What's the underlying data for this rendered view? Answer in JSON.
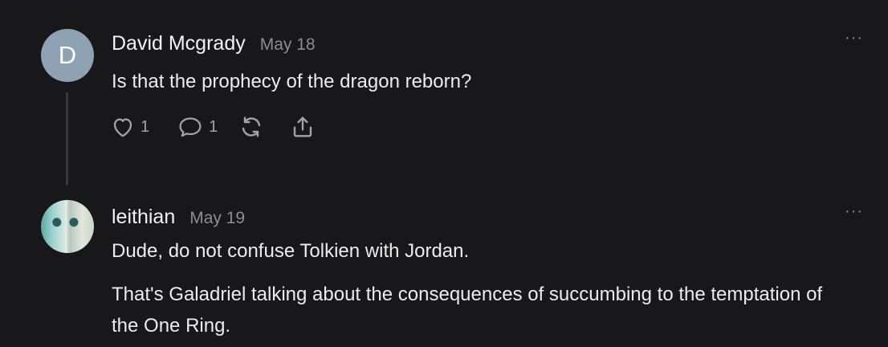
{
  "comments": [
    {
      "avatar_letter": "D",
      "avatar_color": "#8fa2b3",
      "author": "David Mcgrady",
      "date": "May 18",
      "body": [
        "Is that the prophecy of the dragon reborn?"
      ],
      "likes": "1",
      "replies": "1",
      "more_icon": "more-dots-icon"
    },
    {
      "avatar_image": "profile-photo",
      "author": "leithian",
      "date": "May 19",
      "body": [
        "Dude, do not confuse Tolkien with Jordan.",
        "That's Galadriel talking about the consequences of succumbing to the temptation of the One Ring."
      ],
      "more_icon": "more-dots-icon"
    }
  ],
  "colors": {
    "background": "#18181a",
    "text": "#ececec",
    "muted": "#8d8d90",
    "thread_line": "#3a3a3c"
  }
}
